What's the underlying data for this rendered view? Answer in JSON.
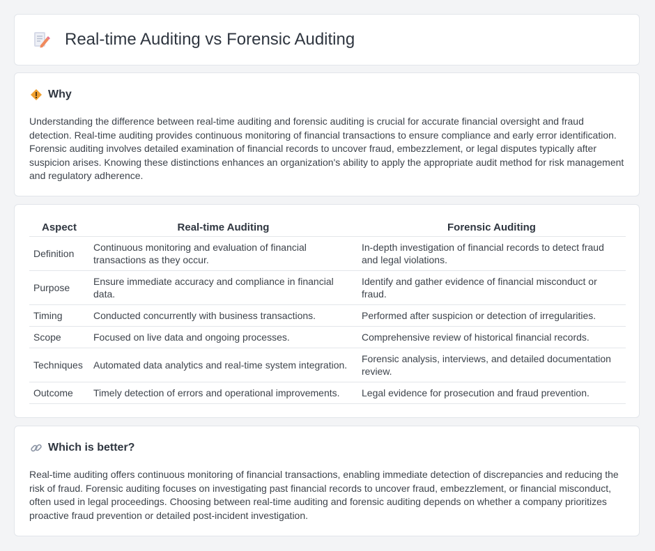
{
  "header": {
    "title": "Real-time Auditing vs Forensic Auditing",
    "icon": "document-pencil-icon"
  },
  "why": {
    "icon": "diamond-warning-icon",
    "heading": "Why",
    "text": "Understanding the difference between real-time auditing and forensic auditing is crucial for accurate financial oversight and fraud detection. Real-time auditing provides continuous monitoring of financial transactions to ensure compliance and early error identification. Forensic auditing involves detailed examination of financial records to uncover fraud, embezzlement, or legal disputes typically after suspicion arises. Knowing these distinctions enhances an organization's ability to apply the appropriate audit method for risk management and regulatory adherence."
  },
  "table": {
    "headers": [
      "Aspect",
      "Real-time Auditing",
      "Forensic Auditing"
    ],
    "rows": [
      [
        "Definition",
        "Continuous monitoring and evaluation of financial transactions as they occur.",
        "In-depth investigation of financial records to detect fraud and legal violations."
      ],
      [
        "Purpose",
        "Ensure immediate accuracy and compliance in financial data.",
        "Identify and gather evidence of financial misconduct or fraud."
      ],
      [
        "Timing",
        "Conducted concurrently with business transactions.",
        "Performed after suspicion or detection of irregularities."
      ],
      [
        "Scope",
        "Focused on live data and ongoing processes.",
        "Comprehensive review of historical financial records."
      ],
      [
        "Techniques",
        "Automated data analytics and real-time system integration.",
        "Forensic analysis, interviews, and detailed documentation review."
      ],
      [
        "Outcome",
        "Timely detection of errors and operational improvements.",
        "Legal evidence for prosecution and fraud prevention."
      ]
    ]
  },
  "better": {
    "icon": "link-icon",
    "heading": "Which is better?",
    "text": "Real-time auditing offers continuous monitoring of financial transactions, enabling immediate detection of discrepancies and reducing the risk of fraud. Forensic auditing focuses on investigating past financial records to uncover fraud, embezzlement, or financial misconduct, often used in legal proceedings. Choosing between real-time auditing and forensic auditing depends on whether a company prioritizes proactive fraud prevention or detailed post-incident investigation."
  },
  "colors": {
    "accent_orange": "#f0a030",
    "icon_pink": "#e8738c",
    "border": "#e2e5ea",
    "background": "#f3f4f6"
  }
}
